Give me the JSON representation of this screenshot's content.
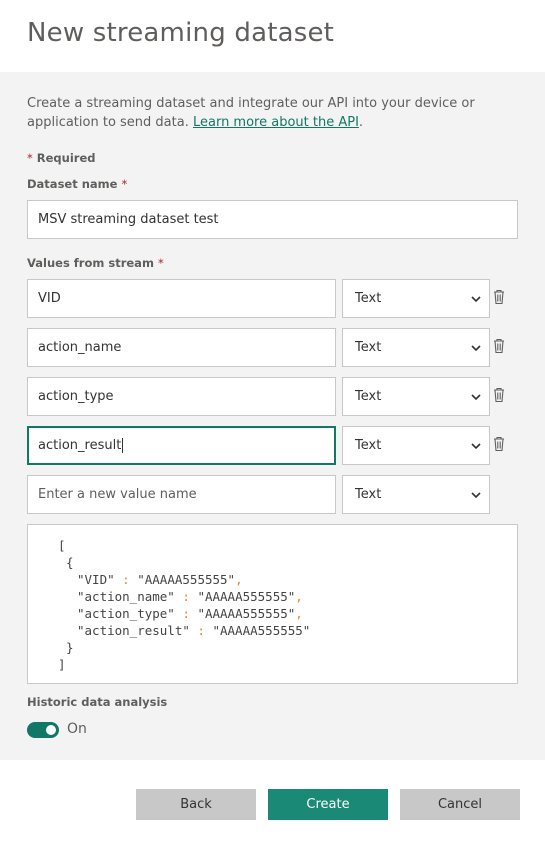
{
  "dialog": {
    "title": "New streaming dataset"
  },
  "description": {
    "text": "Create a streaming dataset and integrate our API into your device or application to send data. ",
    "link": "Learn more about the API",
    "end": "."
  },
  "required_note": {
    "star": "*",
    "text": " Required"
  },
  "dataset_name": {
    "label": "Dataset name",
    "star": "*",
    "value": "MSV streaming dataset test"
  },
  "values_from_stream": {
    "label": "Values from stream",
    "star": "*",
    "rows": [
      {
        "name": "VID",
        "type": "Text"
      },
      {
        "name": "action_name",
        "type": "Text"
      },
      {
        "name": "action_type",
        "type": "Text"
      },
      {
        "name": "action_result",
        "type": "Text"
      }
    ],
    "new_value_placeholder": "Enter a new value name",
    "new_value_type": "Text"
  },
  "json_preview": {
    "open_bracket": "[",
    "open_brace": "{",
    "lines": [
      {
        "key": "\"VID\"",
        "colon": ":",
        "value": "\"AAAAA555555\"",
        "comma": ","
      },
      {
        "key": "\"action_name\"",
        "colon": ":",
        "value": "\"AAAAA555555\"",
        "comma": ","
      },
      {
        "key": "\"action_type\"",
        "colon": ":",
        "value": "\"AAAAA555555\"",
        "comma": ","
      },
      {
        "key": "\"action_result\"",
        "colon": ":",
        "value": "\"AAAAA555555\"",
        "comma": ""
      }
    ],
    "close_brace": "}",
    "close_bracket": "]"
  },
  "historic": {
    "label": "Historic data analysis",
    "state": "On"
  },
  "buttons": {
    "back": "Back",
    "create": "Create",
    "cancel": "Cancel"
  },
  "colors": {
    "accent": "#117865",
    "primary_button": "#1a8a76",
    "panel": "#f3f3f3",
    "required": "#a4262c"
  },
  "icons": {
    "delete": "trash-icon",
    "dropdown": "chevron-down-icon"
  }
}
